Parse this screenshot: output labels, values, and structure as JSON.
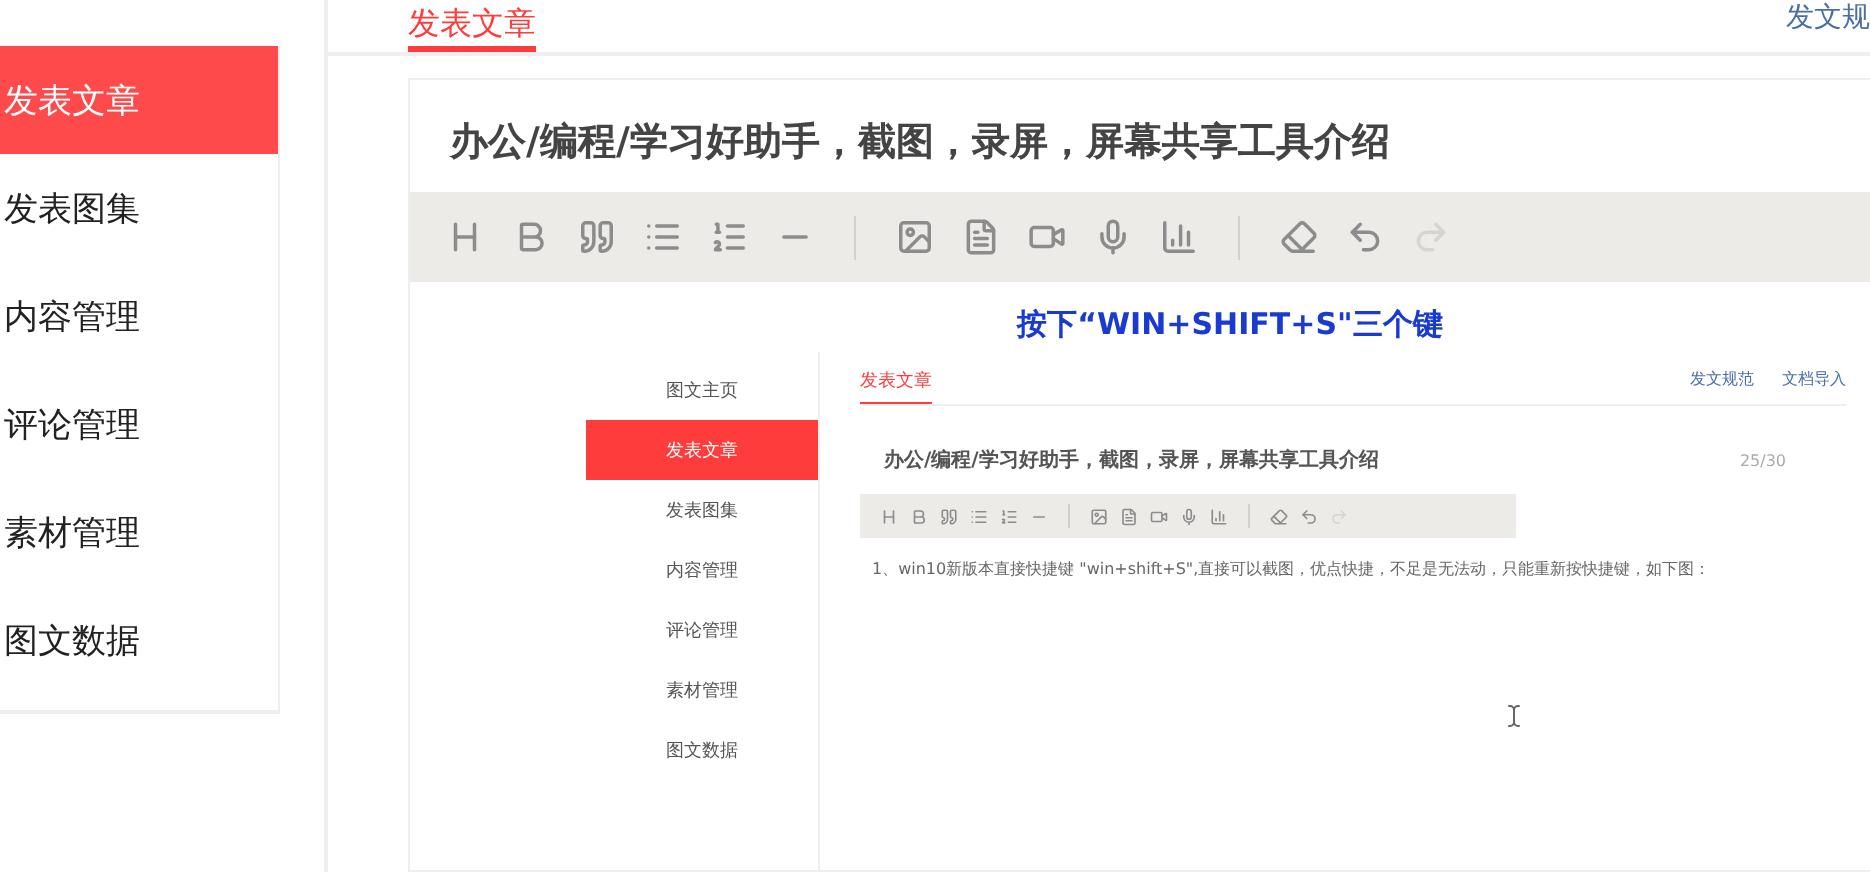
{
  "sidebar": {
    "items": [
      {
        "label": "发表文章",
        "selected": true
      },
      {
        "label": "发表图集",
        "selected": false
      },
      {
        "label": "内容管理",
        "selected": false
      },
      {
        "label": "评论管理",
        "selected": false
      },
      {
        "label": "素材管理",
        "selected": false
      },
      {
        "label": "图文数据",
        "selected": false
      }
    ]
  },
  "tabs": [
    {
      "label": "发表文章",
      "selected": true
    }
  ],
  "header_link": "发文规",
  "editor": {
    "title": "办公/编程/学习好助手，截图，录屏，屏幕共享工具介绍",
    "toolbar": [
      {
        "kind": "heading",
        "disabled": false
      },
      {
        "kind": "bold",
        "disabled": false
      },
      {
        "kind": "quote",
        "disabled": false
      },
      {
        "kind": "list",
        "disabled": false
      },
      {
        "kind": "ordered",
        "disabled": false
      },
      {
        "kind": "rule",
        "disabled": false
      },
      {
        "kind": "separator"
      },
      {
        "kind": "image",
        "disabled": false
      },
      {
        "kind": "document",
        "disabled": false
      },
      {
        "kind": "video",
        "disabled": false
      },
      {
        "kind": "audio",
        "disabled": false
      },
      {
        "kind": "chart",
        "disabled": false
      },
      {
        "kind": "separator"
      },
      {
        "kind": "eraser",
        "disabled": false
      },
      {
        "kind": "undo",
        "disabled": false
      },
      {
        "kind": "redo",
        "disabled": true
      }
    ]
  },
  "screenshot": {
    "caption": "按下“WIN+SHIFT+S\"三个键",
    "sidebar": [
      {
        "label": "图文主页",
        "selected": false
      },
      {
        "label": "发表文章",
        "selected": true
      },
      {
        "label": "发表图集",
        "selected": false
      },
      {
        "label": "内容管理",
        "selected": false
      },
      {
        "label": "评论管理",
        "selected": false
      },
      {
        "label": "素材管理",
        "selected": false
      },
      {
        "label": "图文数据",
        "selected": false
      }
    ],
    "tabs": [
      {
        "label": "发表文章",
        "selected": true
      }
    ],
    "links": [
      "发文规范",
      "文档导入"
    ],
    "title": "办公/编程/学习好助手，截图，录屏，屏幕共享工具介绍",
    "counter": "25/30",
    "toolbar": [
      {
        "kind": "heading",
        "disabled": false
      },
      {
        "kind": "bold",
        "disabled": false
      },
      {
        "kind": "quote",
        "disabled": false
      },
      {
        "kind": "list",
        "disabled": false
      },
      {
        "kind": "ordered",
        "disabled": false
      },
      {
        "kind": "rule",
        "disabled": false
      },
      {
        "kind": "separator"
      },
      {
        "kind": "image",
        "disabled": false
      },
      {
        "kind": "document",
        "disabled": false
      },
      {
        "kind": "video",
        "disabled": false
      },
      {
        "kind": "audio",
        "disabled": false
      },
      {
        "kind": "chart",
        "disabled": false
      },
      {
        "kind": "separator"
      },
      {
        "kind": "eraser",
        "disabled": false
      },
      {
        "kind": "undo",
        "disabled": false
      },
      {
        "kind": "redo",
        "disabled": true
      }
    ],
    "body": "1、win10新版本直接快捷键 \"win+shift+S\",直接可以截图，优点快捷，不足是无法动，只能重新按快捷键，如下图："
  }
}
